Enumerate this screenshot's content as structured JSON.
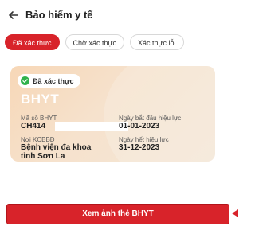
{
  "header": {
    "title": "Bảo hiểm y tế"
  },
  "tabs": [
    {
      "label": "Đã xác thực",
      "active": true
    },
    {
      "label": "Chờ xác thực",
      "active": false
    },
    {
      "label": "Xác thực lỗi",
      "active": false
    }
  ],
  "card": {
    "status": "Đã xác thực",
    "type": "BHYT",
    "fields": {
      "insurance_number_label": "Mã số BHYT",
      "insurance_number_value": "CH414",
      "start_date_label": "Ngày bắt đầu hiệu lực",
      "start_date_value": "01-01-2023",
      "facility_label": "Nơi KCBBĐ",
      "facility_line1": "Bệnh viện đa khoa",
      "facility_line2": "tỉnh Sơn La",
      "end_date_label": "Ngày hết hiệu lực",
      "end_date_value": "31-12-2023"
    }
  },
  "actions": {
    "view_card_label": "Xem ảnh thẻ BHYT"
  },
  "colors": {
    "accent": "#d8232a",
    "verified": "#2fb24c",
    "card_bg": "#f6dcc2"
  },
  "icons": {
    "back": "arrow-left-icon",
    "verified": "check-circle-icon",
    "pointer": "arrow-pointer-icon"
  }
}
